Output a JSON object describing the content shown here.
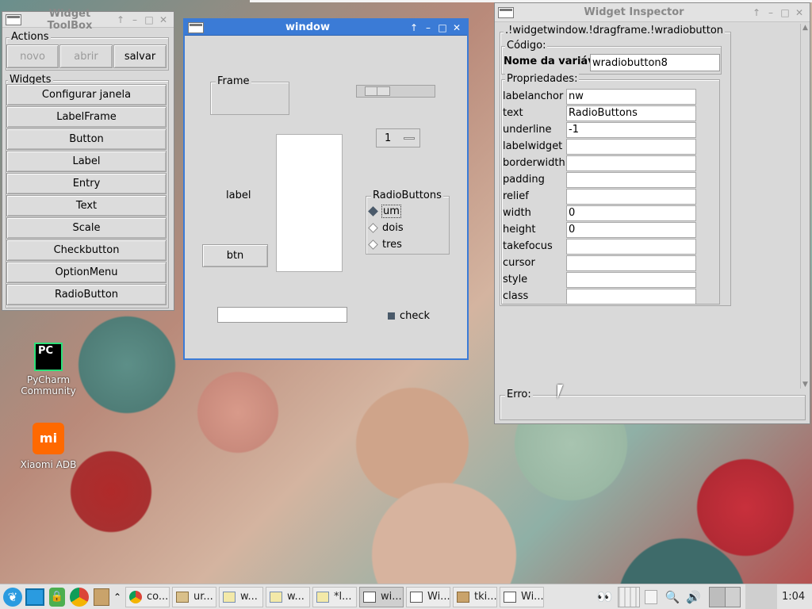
{
  "toolbox": {
    "title": "Widget ToolBox",
    "actions_label": "Actions",
    "btn_novo": "novo",
    "btn_abrir": "abrir",
    "btn_salvar": "salvar",
    "widgets_label": "Widgets",
    "widgets": [
      "Configurar janela",
      "LabelFrame",
      "Button",
      "Label",
      "Entry",
      "Text",
      "Scale",
      "Checkbutton",
      "OptionMenu",
      "RadioButton"
    ]
  },
  "preview": {
    "title": "window",
    "frame_label": "Frame",
    "label_text": "label",
    "btn_text": "btn",
    "spin_value": "1",
    "radio_group_label": "RadioButtons",
    "radios": [
      "um",
      "dois",
      "tres"
    ],
    "selected_radio": "um",
    "check_label": "check",
    "entry_value": "",
    "scale_position": 0.15
  },
  "inspector": {
    "title": "Widget Inspector",
    "path": ".!widgetwindow.!dragframe.!wradiobutton",
    "codigo_label": "Código:",
    "varname_label": "Nome da variável",
    "varname_value": "wradiobutton8",
    "props_label": "Propriedades:",
    "props": [
      {
        "name": "labelanchor",
        "value": "nw"
      },
      {
        "name": "text",
        "value": "RadioButtons"
      },
      {
        "name": "underline",
        "value": "-1"
      },
      {
        "name": "labelwidget",
        "value": ""
      },
      {
        "name": "borderwidth",
        "value": ""
      },
      {
        "name": "padding",
        "value": ""
      },
      {
        "name": "relief",
        "value": ""
      },
      {
        "name": "width",
        "value": "0"
      },
      {
        "name": "height",
        "value": "0"
      },
      {
        "name": "takefocus",
        "value": ""
      },
      {
        "name": "cursor",
        "value": ""
      },
      {
        "name": "style",
        "value": ""
      },
      {
        "name": "class",
        "value": ""
      }
    ],
    "erro_label": "Erro:"
  },
  "desktop": {
    "icons": [
      {
        "name": "pycharm",
        "glyph": "PC",
        "label": "PyCharm Community"
      },
      {
        "name": "xiaomi-adb",
        "glyph": "mi",
        "label": "Xiaomi ADB"
      }
    ]
  },
  "taskbar": {
    "items": [
      {
        "label": "co...",
        "icon": "chrome-icon"
      },
      {
        "label": "ur...",
        "icon": "folder-icon"
      },
      {
        "label": "w...",
        "icon": "python-icon"
      },
      {
        "label": "w...",
        "icon": "python-icon"
      },
      {
        "label": "*l...",
        "icon": "python-icon"
      },
      {
        "label": "wi...",
        "icon": "window-icon",
        "active": true
      },
      {
        "label": "Wi...",
        "icon": "window-icon"
      },
      {
        "label": "tki...",
        "icon": "notes-icon"
      },
      {
        "label": "Wi...",
        "icon": "window-icon"
      }
    ],
    "clock": "1:04"
  },
  "colors": {
    "accent": "#3b7bd6",
    "pycharm_bg": "#000000",
    "xiaomi_bg": "#ff6900"
  }
}
